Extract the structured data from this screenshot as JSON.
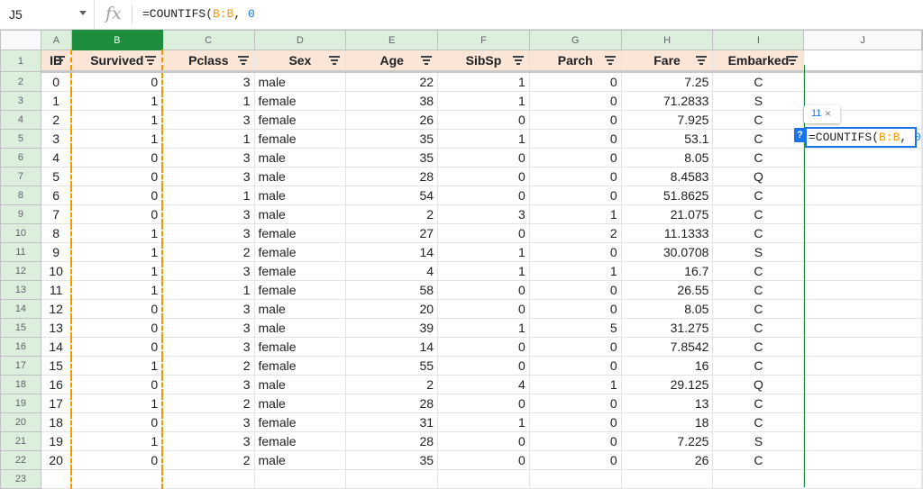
{
  "formula_bar": {
    "name_box": "J5",
    "fx_label": "fx",
    "formula_prefix": "=COUNTIFS(",
    "formula_range": "B:B",
    "formula_sep": ", ",
    "formula_value": "0"
  },
  "columns": [
    "A",
    "B",
    "C",
    "D",
    "E",
    "F",
    "G",
    "H",
    "I",
    "J"
  ],
  "active_column": "B",
  "header_row": {
    "row_number": "1",
    "labels": [
      "ID",
      "Survived",
      "Pclass",
      "Sex",
      "Age",
      "SibSp",
      "Parch",
      "Fare",
      "Embarked"
    ]
  },
  "rows": [
    {
      "n": "2",
      "v": [
        "0",
        "0",
        "3",
        "male",
        "22",
        "1",
        "0",
        "7.25",
        "C"
      ]
    },
    {
      "n": "3",
      "v": [
        "1",
        "1",
        "1",
        "female",
        "38",
        "1",
        "0",
        "71.2833",
        "S"
      ]
    },
    {
      "n": "4",
      "v": [
        "2",
        "1",
        "3",
        "female",
        "26",
        "0",
        "0",
        "7.925",
        "C"
      ]
    },
    {
      "n": "5",
      "v": [
        "3",
        "1",
        "1",
        "female",
        "35",
        "1",
        "0",
        "53.1",
        "C"
      ]
    },
    {
      "n": "6",
      "v": [
        "4",
        "0",
        "3",
        "male",
        "35",
        "0",
        "0",
        "8.05",
        "C"
      ]
    },
    {
      "n": "7",
      "v": [
        "5",
        "0",
        "3",
        "male",
        "28",
        "0",
        "0",
        "8.4583",
        "Q"
      ]
    },
    {
      "n": "8",
      "v": [
        "6",
        "0",
        "1",
        "male",
        "54",
        "0",
        "0",
        "51.8625",
        "C"
      ]
    },
    {
      "n": "9",
      "v": [
        "7",
        "0",
        "3",
        "male",
        "2",
        "3",
        "1",
        "21.075",
        "C"
      ]
    },
    {
      "n": "10",
      "v": [
        "8",
        "1",
        "3",
        "female",
        "27",
        "0",
        "2",
        "11.1333",
        "C"
      ]
    },
    {
      "n": "11",
      "v": [
        "9",
        "1",
        "2",
        "female",
        "14",
        "1",
        "0",
        "30.0708",
        "S"
      ]
    },
    {
      "n": "12",
      "v": [
        "10",
        "1",
        "3",
        "female",
        "4",
        "1",
        "1",
        "16.7",
        "C"
      ]
    },
    {
      "n": "13",
      "v": [
        "11",
        "1",
        "1",
        "female",
        "58",
        "0",
        "0",
        "26.55",
        "C"
      ]
    },
    {
      "n": "14",
      "v": [
        "12",
        "0",
        "3",
        "male",
        "20",
        "0",
        "0",
        "8.05",
        "C"
      ]
    },
    {
      "n": "15",
      "v": [
        "13",
        "0",
        "3",
        "male",
        "39",
        "1",
        "5",
        "31.275",
        "C"
      ]
    },
    {
      "n": "16",
      "v": [
        "14",
        "0",
        "3",
        "female",
        "14",
        "0",
        "0",
        "7.8542",
        "C"
      ]
    },
    {
      "n": "17",
      "v": [
        "15",
        "1",
        "2",
        "female",
        "55",
        "0",
        "0",
        "16",
        "C"
      ]
    },
    {
      "n": "18",
      "v": [
        "16",
        "0",
        "3",
        "male",
        "2",
        "4",
        "1",
        "29.125",
        "Q"
      ]
    },
    {
      "n": "19",
      "v": [
        "17",
        "1",
        "2",
        "male",
        "28",
        "0",
        "0",
        "13",
        "C"
      ]
    },
    {
      "n": "20",
      "v": [
        "18",
        "0",
        "3",
        "female",
        "31",
        "1",
        "0",
        "18",
        "C"
      ]
    },
    {
      "n": "21",
      "v": [
        "19",
        "1",
        "3",
        "female",
        "28",
        "0",
        "0",
        "7.225",
        "S"
      ]
    },
    {
      "n": "22",
      "v": [
        "20",
        "0",
        "2",
        "male",
        "35",
        "0",
        "0",
        "26",
        "C"
      ]
    }
  ],
  "empty_row": {
    "n": "23"
  },
  "editor": {
    "hint_count": "11",
    "hint_close": "×",
    "help_label": "?",
    "text_prefix": "=COUNTIFS(",
    "text_range": "B:B",
    "text_sep": ", ",
    "text_value": "0"
  },
  "colors": {
    "accent": "#1a73e8",
    "range_ref": "#f29900",
    "header_fill": "#fbe5d6",
    "active_col": "#1e8e3e"
  }
}
